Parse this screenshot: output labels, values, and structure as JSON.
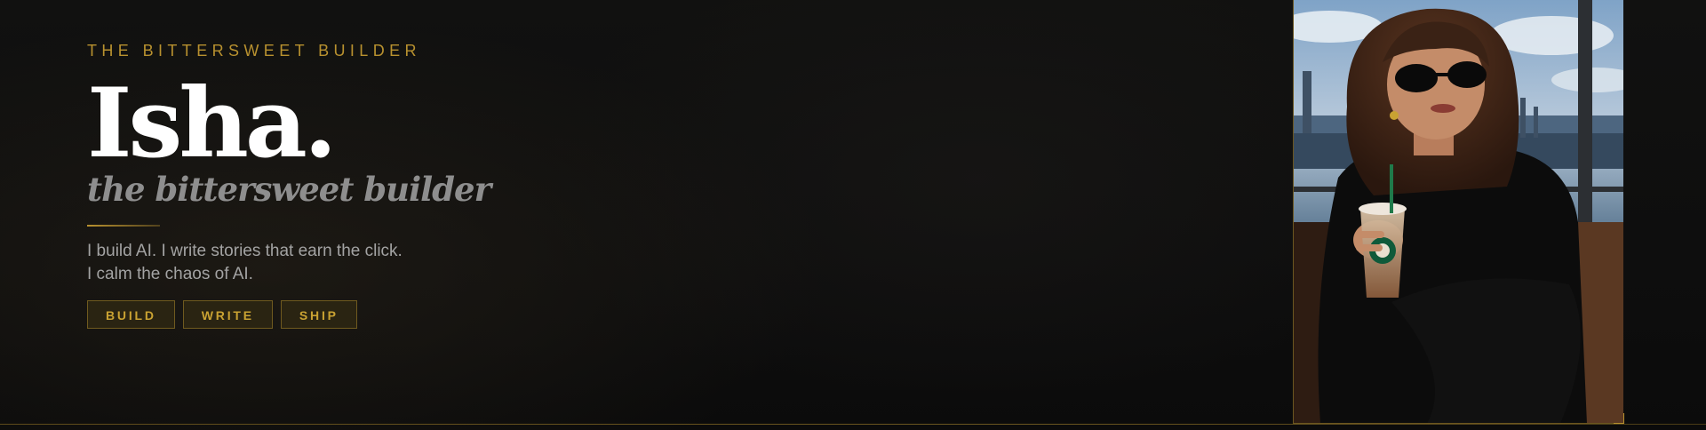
{
  "hero": {
    "eyebrow": "THE BITTERSWEET BUILDER",
    "name": "Isha.",
    "tagline": "the bittersweet builder",
    "bio_lines": [
      "I build AI. I write stories that earn the click.",
      "I calm the chaos of AI."
    ],
    "tags": [
      "BUILD",
      "WRITE",
      "SHIP"
    ]
  },
  "colors": {
    "accent": "#b8912f",
    "background": "#0d0d0d",
    "heading": "#ffffff",
    "subheading": "#8e8e8e",
    "body_text": "#a3a3a3"
  }
}
